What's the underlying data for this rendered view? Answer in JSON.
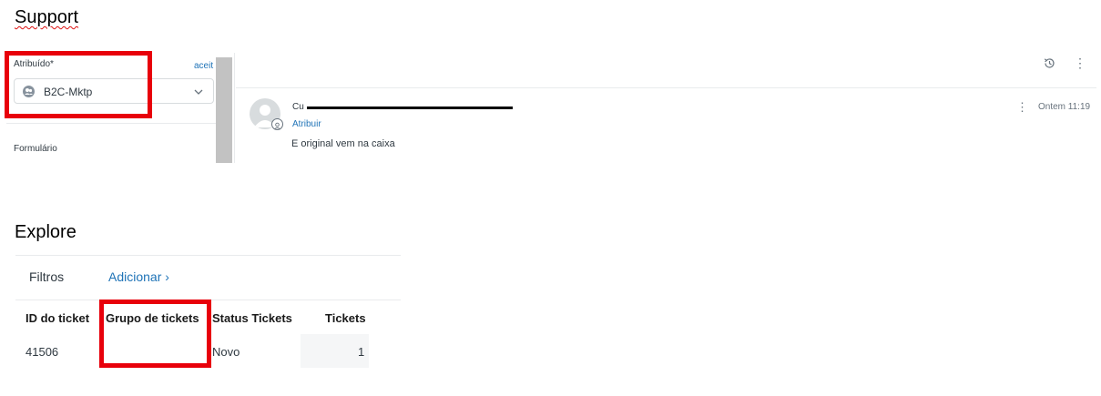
{
  "support": {
    "heading": "Support",
    "assignee_label": "Atribuído*",
    "accept_link": "aceit",
    "assignee_value": "B2C-Mktp",
    "form_label": "Formulário",
    "message": {
      "author": "Cu",
      "assign_link": "Atribuir",
      "body": "E original vem na caixa",
      "time": "Ontem 11:19"
    }
  },
  "explore": {
    "heading": "Explore",
    "filters_label": "Filtros",
    "add_link": "Adicionar ›",
    "columns": [
      "ID do ticket",
      "Grupo de tickets",
      "Status Tickets",
      "Tickets"
    ],
    "rows": [
      {
        "id": "41506",
        "group": "",
        "status": "Novo",
        "tickets": "1"
      }
    ]
  },
  "colors": {
    "highlight": "#e8000b",
    "link": "#1f73b7"
  },
  "icons": [
    "group-icon",
    "chevron-down-icon",
    "history-icon",
    "more-vertical-icon",
    "user-avatar-icon",
    "agent-badge-icon"
  ]
}
